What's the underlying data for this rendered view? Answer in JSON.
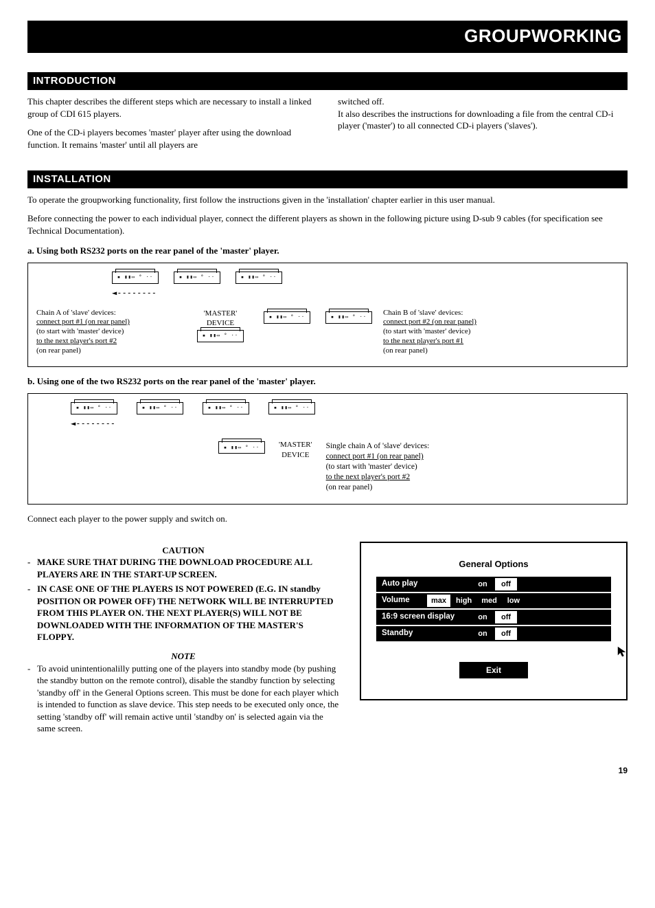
{
  "banner": "GROUPWORKING",
  "intro": {
    "heading": "INTRODUCTION",
    "col1_p1": "This chapter describes the different steps which are necessary to install a linked group of CDI 615 players.",
    "col1_p2": "One of the CD-i players becomes 'master' player after using the download function. It remains 'master' until all players are",
    "col2_p1": "switched off.",
    "col2_p2": "It also describes the instructions for downloading a file from the central CD-i player ('master') to all connected CD-i players ('slaves')."
  },
  "install": {
    "heading": "INSTALLATION",
    "p1": "To operate the groupworking functionality, first follow the instructions given in the 'installation' chapter earlier in this user manual.",
    "p2": "Before connecting the power to each individual player, connect the different players as shown in the following picture using D-sub 9 cables (for specification see Technical Documentation).",
    "caption_a": "a. Using both RS232 ports on the rear panel of the 'master' player.",
    "caption_b": "b. Using one of the two RS232 ports on the rear panel of the 'master' player.",
    "post_b": "Connect each player to the power supply and switch on."
  },
  "diagram_a": {
    "chain_a_l1": "Chain A of 'slave' devices:",
    "chain_a_l2": "connect port #1 (on rear panel)",
    "chain_a_l3": "(to start with 'master' device)",
    "chain_a_l4": "to the next player's port #2",
    "chain_a_l5": "(on rear panel)",
    "master_l1": "'MASTER'",
    "master_l2": "DEVICE",
    "chain_b_l1": "Chain B of 'slave' devices:",
    "chain_b_l2": "connect port #2 (on rear panel)",
    "chain_b_l3": "(to start with 'master' device)",
    "chain_b_l4": "to the next player's port #1",
    "chain_b_l5": "(on rear panel)",
    "arrow_left": "◄--------"
  },
  "diagram_b": {
    "single_l1": "Single chain A of 'slave' devices:",
    "single_l2": "connect port #1 (on rear panel)",
    "single_l3": "(to start with 'master' device)",
    "single_l4": "to the next player's port #2",
    "single_l5": "(on rear panel)",
    "master_l1": "'MASTER'",
    "master_l2": "DEVICE",
    "arrow_left": "◄--------"
  },
  "caution": {
    "title": "CAUTION",
    "b1": "MAKE SURE THAT DURING THE DOWNLOAD PROCEDURE ALL PLAYERS ARE IN THE START-UP SCREEN.",
    "b2": "IN CASE ONE OF THE PLAYERS IS NOT POWERED (E.G. IN standby POSITION OR POWER OFF) THE NETWORK WILL BE INTERRUPTED FROM THIS PLAYER ON. THE NEXT PLAYER(S) WILL NOT BE DOWNLOADED WITH THE INFORMATION OF THE MASTER'S FLOPPY."
  },
  "note": {
    "title": "NOTE",
    "b1": "To avoid unintentionalilly putting one of the players into standby mode (by pushing the standby button on the remote control), disable the standby function by selecting 'standby off' in the General Options screen. This must be done for each player which is intended to function as slave device. This step needs to be executed only once, the setting 'standby off' will remain active until 'standby on' is selected again via the same screen."
  },
  "screen": {
    "title": "General Options",
    "rows": {
      "auto_play": {
        "label": "Auto play",
        "on": "on",
        "off": "off"
      },
      "volume": {
        "label": "Volume",
        "max": "max",
        "high": "high",
        "med": "med",
        "low": "low"
      },
      "aspect": {
        "label": "16:9 screen display",
        "on": "on",
        "off": "off"
      },
      "standby": {
        "label": "Standby",
        "on": "on",
        "off": "off"
      }
    },
    "exit": "Exit"
  },
  "page_number": "19"
}
